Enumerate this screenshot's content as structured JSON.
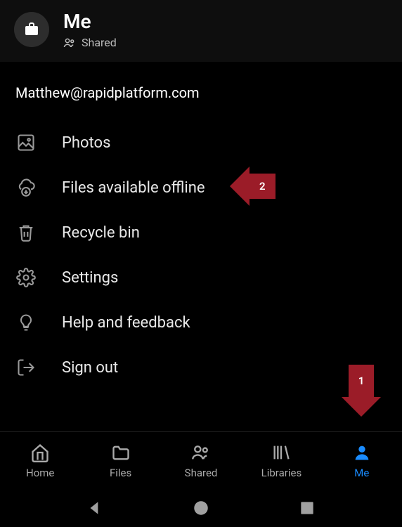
{
  "header": {
    "title": "Me",
    "shared_label": "Shared"
  },
  "email": "Matthew@rapidplatform.com",
  "menu": {
    "photos": "Photos",
    "offline": "Files available offline",
    "recycle": "Recycle bin",
    "settings": "Settings",
    "help": "Help and feedback",
    "signout": "Sign out"
  },
  "nav": {
    "home": "Home",
    "files": "Files",
    "shared": "Shared",
    "libraries": "Libraries",
    "me": "Me"
  },
  "annotations": {
    "arrow1": "1",
    "arrow2": "2"
  },
  "colors": {
    "accent": "#1a8cff",
    "annotation": "#9b1c28"
  }
}
